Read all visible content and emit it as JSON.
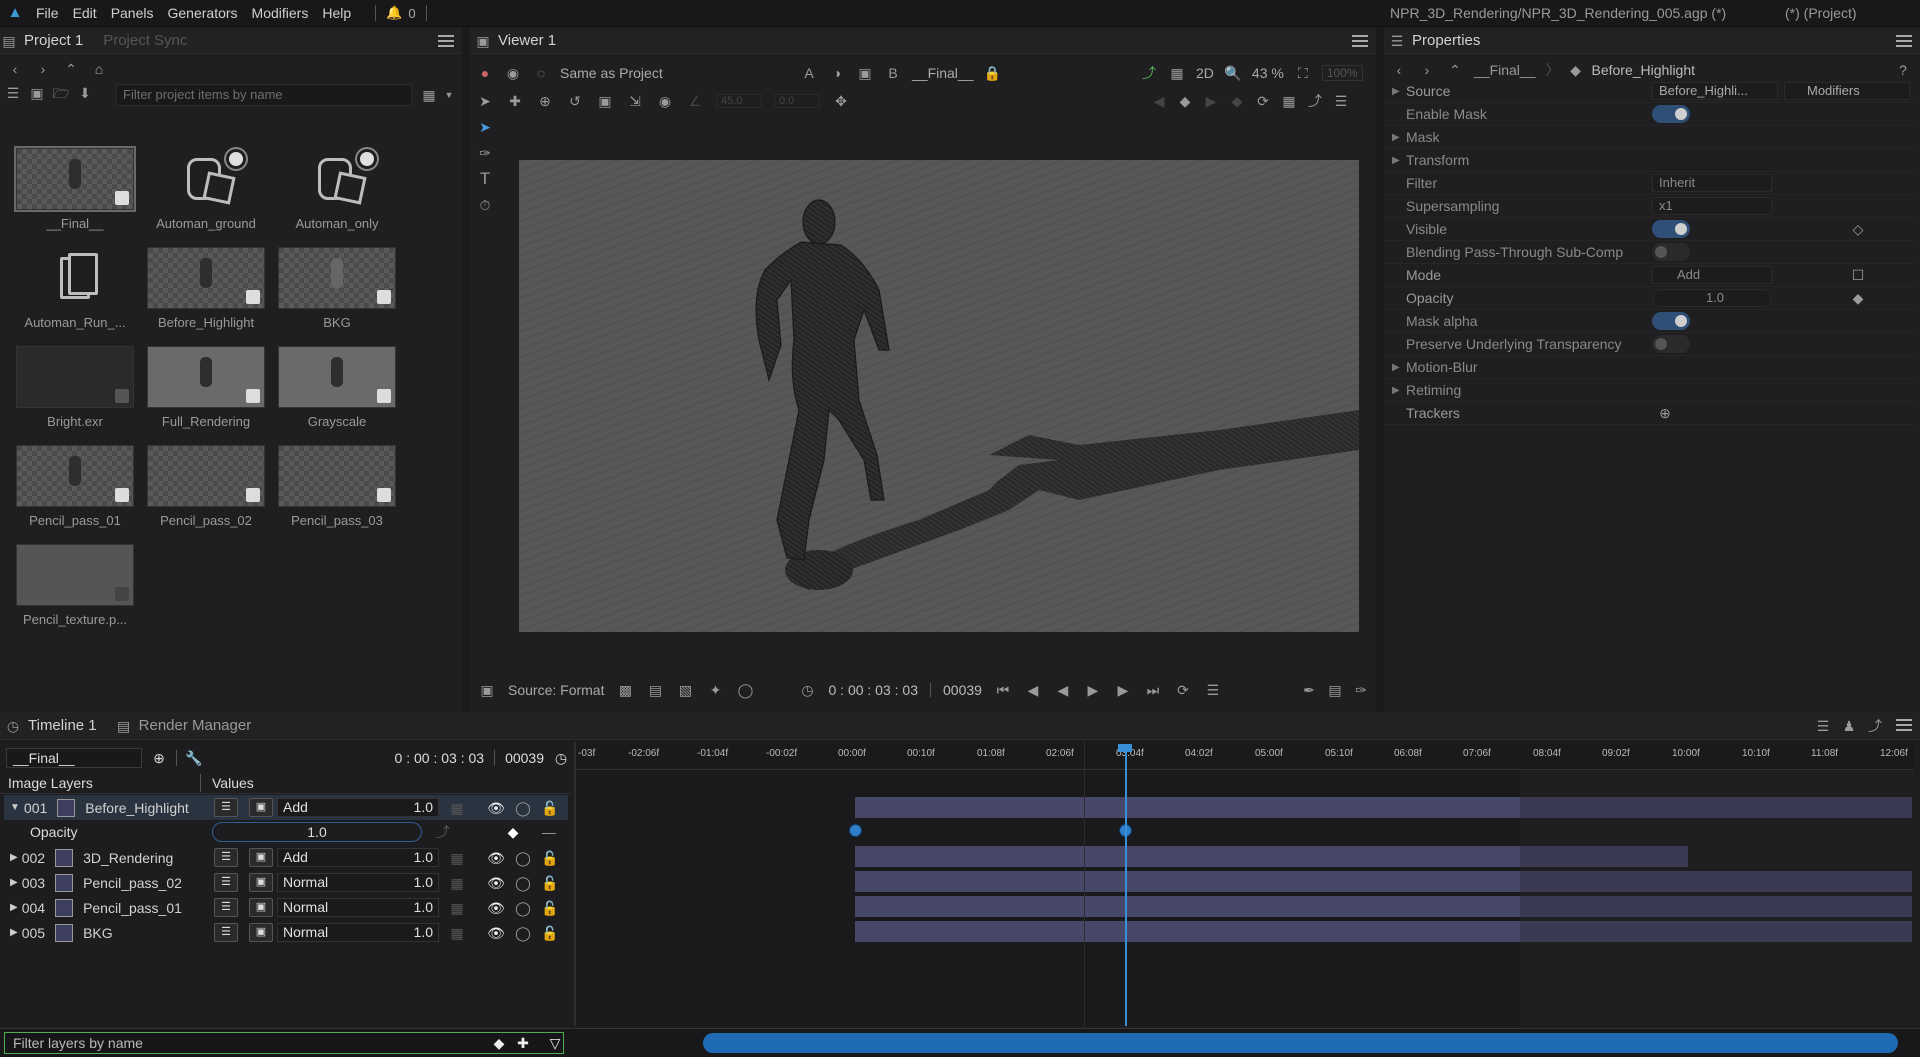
{
  "menubar": {
    "items": [
      "File",
      "Edit",
      "Panels",
      "Generators",
      "Modifiers",
      "Help"
    ],
    "notifications": "0",
    "doc_title": "NPR_3D_Rendering/NPR_3D_Rendering_005.agp (*)",
    "project_label": "(*) (Project)"
  },
  "project_panel": {
    "tab": "Project 1",
    "tab2": "Project Sync",
    "filter_placeholder": "Filter project items by name",
    "items": [
      "__Final__",
      "Automan_ground",
      "Automan_only",
      "Automan_Run_...",
      "Before_Highlight",
      "BKG",
      "Bright.exr",
      "Full_Rendering",
      "Grayscale",
      "Pencil_pass_01",
      "Pencil_pass_02",
      "Pencil_pass_03",
      "Pencil_texture.p..."
    ]
  },
  "viewer": {
    "tab": "Viewer 1",
    "color_mode": "Same as Project",
    "comp_name": "__Final__",
    "view_mode": "2D",
    "zoom": "43 %",
    "zoom2": "100%",
    "val1": "45.0",
    "val2": "0.0",
    "source_label": "Source: Format",
    "timecode": "0 : 00 : 03 : 03",
    "frame": "00039"
  },
  "properties": {
    "tab": "Properties",
    "breadcrumb1": "__Final__",
    "breadcrumb2": "Before_Highlight",
    "source_value": "Before_Highli...",
    "modifiers_button": "Modifiers",
    "rows": {
      "source": "Source",
      "enable_mask": "Enable Mask",
      "mask": "Mask",
      "transform": "Transform",
      "filter": "Filter",
      "filter_val": "Inherit",
      "supersampling": "Supersampling",
      "supersampling_val": "x1",
      "visible": "Visible",
      "blending": "Blending Pass-Through Sub-Comp",
      "mode": "Mode",
      "mode_val": "Add",
      "opacity": "Opacity",
      "opacity_val": "1.0",
      "mask_alpha": "Mask alpha",
      "preserve": "Preserve Underlying Transparency",
      "motion_blur": "Motion-Blur",
      "retiming": "Retiming",
      "trackers": "Trackers"
    }
  },
  "timeline": {
    "tab": "Timeline 1",
    "tab2": "Render Manager",
    "comp": "__Final__",
    "timecode": "0 : 00 : 03 : 03",
    "frame": "00039",
    "col1": "Image Layers",
    "col2": "Values",
    "opacity_label": "Opacity",
    "opacity_value": "1.0",
    "filter_placeholder": "Filter layers by name",
    "ruler": [
      "-03f",
      "-02:06f",
      "-01:04f",
      "-00:02f",
      "00:00f",
      "00:10f",
      "01:08f",
      "02:06f",
      "03:04f",
      "04:02f",
      "05:00f",
      "05:10f",
      "06:08f",
      "07:06f",
      "08:04f",
      "09:02f",
      "10:00f",
      "10:10f",
      "11:08f",
      "12:06f"
    ],
    "layers": [
      {
        "num": "001",
        "name": "Before_Highlight",
        "mode": "Add",
        "value": "1.0"
      },
      {
        "num": "002",
        "name": "3D_Rendering",
        "mode": "Add",
        "value": "1.0"
      },
      {
        "num": "003",
        "name": "Pencil_pass_02",
        "mode": "Normal",
        "value": "1.0"
      },
      {
        "num": "004",
        "name": "Pencil_pass_01",
        "mode": "Normal",
        "value": "1.0"
      },
      {
        "num": "005",
        "name": "BKG",
        "mode": "Normal",
        "value": "1.0"
      }
    ]
  }
}
